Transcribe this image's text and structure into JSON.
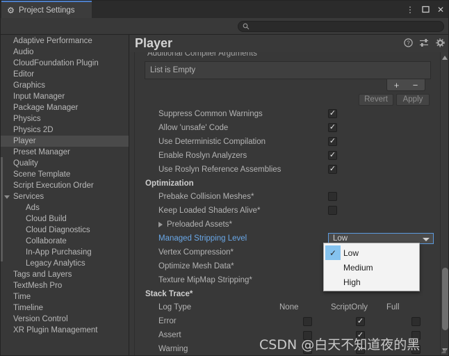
{
  "window": {
    "tab_title": "Project Settings",
    "tab_icon": "gear-icon",
    "buttons": {
      "menu": "⋮",
      "maximize": "❐",
      "close": "✕"
    }
  },
  "search": {
    "placeholder": "",
    "value": "",
    "icon": "search-icon"
  },
  "sidebar": {
    "items": [
      {
        "label": "Adaptive Performance",
        "level": 0,
        "selected": false,
        "arrow": "none"
      },
      {
        "label": "Audio",
        "level": 0,
        "selected": false,
        "arrow": "none"
      },
      {
        "label": "CloudFoundation Plugin",
        "level": 0,
        "selected": false,
        "arrow": "none"
      },
      {
        "label": "Editor",
        "level": 0,
        "selected": false,
        "arrow": "none"
      },
      {
        "label": "Graphics",
        "level": 0,
        "selected": false,
        "arrow": "none"
      },
      {
        "label": "Input Manager",
        "level": 0,
        "selected": false,
        "arrow": "none"
      },
      {
        "label": "Package Manager",
        "level": 0,
        "selected": false,
        "arrow": "none"
      },
      {
        "label": "Physics",
        "level": 0,
        "selected": false,
        "arrow": "none"
      },
      {
        "label": "Physics 2D",
        "level": 0,
        "selected": false,
        "arrow": "none"
      },
      {
        "label": "Player",
        "level": 0,
        "selected": true,
        "arrow": "none"
      },
      {
        "label": "Preset Manager",
        "level": 0,
        "selected": false,
        "arrow": "none"
      },
      {
        "label": "Quality",
        "level": 0,
        "selected": false,
        "arrow": "none"
      },
      {
        "label": "Scene Template",
        "level": 0,
        "selected": false,
        "arrow": "none"
      },
      {
        "label": "Script Execution Order",
        "level": 0,
        "selected": false,
        "arrow": "none"
      },
      {
        "label": "Services",
        "level": 0,
        "selected": false,
        "arrow": "open"
      },
      {
        "label": "Ads",
        "level": 1,
        "selected": false,
        "arrow": "none"
      },
      {
        "label": "Cloud Build",
        "level": 1,
        "selected": false,
        "arrow": "none"
      },
      {
        "label": "Cloud Diagnostics",
        "level": 1,
        "selected": false,
        "arrow": "none"
      },
      {
        "label": "Collaborate",
        "level": 1,
        "selected": false,
        "arrow": "none"
      },
      {
        "label": "In-App Purchasing",
        "level": 1,
        "selected": false,
        "arrow": "none"
      },
      {
        "label": "Legacy Analytics",
        "level": 1,
        "selected": false,
        "arrow": "none"
      },
      {
        "label": "Tags and Layers",
        "level": 0,
        "selected": false,
        "arrow": "none"
      },
      {
        "label": "TextMesh Pro",
        "level": 0,
        "selected": false,
        "arrow": "none"
      },
      {
        "label": "Time",
        "level": 0,
        "selected": false,
        "arrow": "none"
      },
      {
        "label": "Timeline",
        "level": 0,
        "selected": false,
        "arrow": "none"
      },
      {
        "label": "Version Control",
        "level": 0,
        "selected": false,
        "arrow": "none"
      },
      {
        "label": "XR Plugin Management",
        "level": 0,
        "selected": false,
        "arrow": "none"
      }
    ]
  },
  "main": {
    "title": "Player",
    "header_icons": [
      {
        "name": "help-icon",
        "glyph": "?"
      },
      {
        "name": "preset-icon",
        "glyph": "⇄"
      },
      {
        "name": "settings-gear-icon",
        "glyph": "⚙"
      }
    ],
    "clipped_label": "Additional Compiler Arguments",
    "list_empty_text": "List is Empty",
    "list_add_label": "+",
    "list_remove_label": "−",
    "revert_label": "Revert",
    "apply_label": "Apply",
    "checkbox_rows": [
      {
        "label": "Suppress Common Warnings",
        "checked": true
      },
      {
        "label": "Allow 'unsafe' Code",
        "checked": true
      },
      {
        "label": "Use Deterministic Compilation",
        "checked": true
      },
      {
        "label": "Enable Roslyn Analyzers",
        "checked": true
      },
      {
        "label": "Use Roslyn Reference Assemblies",
        "checked": true
      }
    ],
    "optimization_section": "Optimization",
    "optimization_rows": [
      {
        "label": "Prebake Collision Meshes*",
        "checked": false
      },
      {
        "label": "Keep Loaded Shaders Alive*",
        "checked": false
      }
    ],
    "preloaded_assets_label": "Preloaded Assets*",
    "managed_stripping": {
      "label": "Managed Stripping Level",
      "value": "Low",
      "options": [
        "Low",
        "Medium",
        "High"
      ],
      "selected_index": 0,
      "accent_color": "#5c9ade",
      "highlight_color": "#85c3ef"
    },
    "post_dropdown_rows": [
      "Vertex Compression*",
      "Optimize Mesh Data*",
      "Texture MipMap Stripping*"
    ],
    "stack_trace": {
      "section": "Stack Trace*",
      "row_label": "Log Type",
      "columns": [
        "None",
        "ScriptOnly",
        "Full"
      ],
      "rows": [
        {
          "label": "Error",
          "selected_column": 1
        },
        {
          "label": "Assert",
          "selected_column": 1
        },
        {
          "label": "Warning",
          "selected_column": 1
        }
      ]
    }
  },
  "watermark": "CSDN @白天不知道夜的黑"
}
